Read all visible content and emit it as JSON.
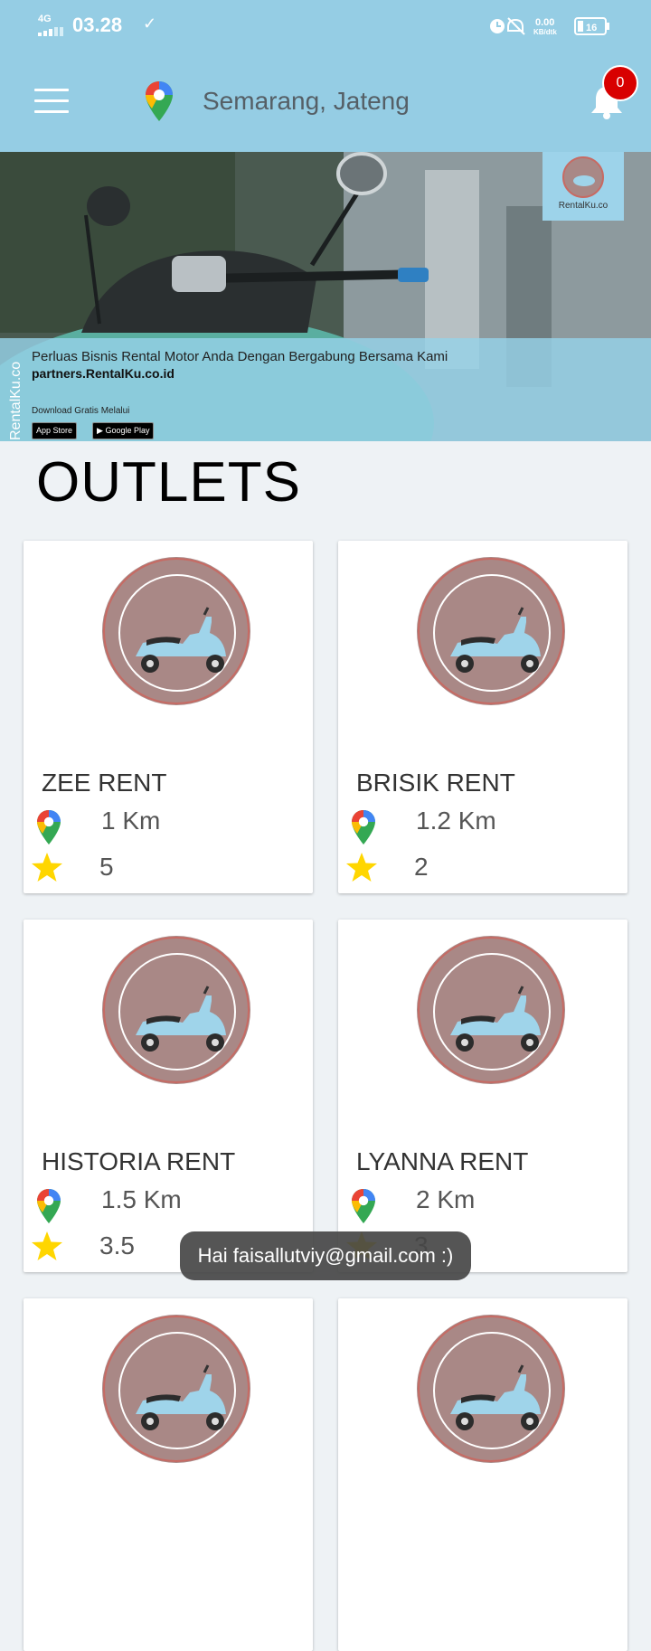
{
  "status": {
    "network": "4G",
    "time": "03.28",
    "speed": "0.00",
    "speed_unit": "KB/dtk",
    "battery": "16"
  },
  "header": {
    "location": "Semarang, Jateng",
    "notification_count": "0"
  },
  "banner": {
    "text": "Perluas Bisnis Rental Motor Anda Dengan Bergabung Bersama Kami",
    "link": "partners.RentalKu.co.id",
    "download": "Download Gratis Melalui",
    "app_store": "App Store",
    "google_play": "Google Play",
    "vertical": "RentalKu.co",
    "logo_text": "RentalKu.co"
  },
  "page_title": "OUTLETS",
  "outlets": [
    {
      "name": "ZEE RENT",
      "distance": "1 Km",
      "rating": "5"
    },
    {
      "name": "BRISIK RENT",
      "distance": "1.2 Km",
      "rating": "2"
    },
    {
      "name": "HISTORIA RENT",
      "distance": "1.5 Km",
      "rating": "3.5"
    },
    {
      "name": "LYANNA RENT",
      "distance": "2 Km",
      "rating": "3"
    }
  ],
  "toast": "Hai faisallutviy@gmail.com :)"
}
